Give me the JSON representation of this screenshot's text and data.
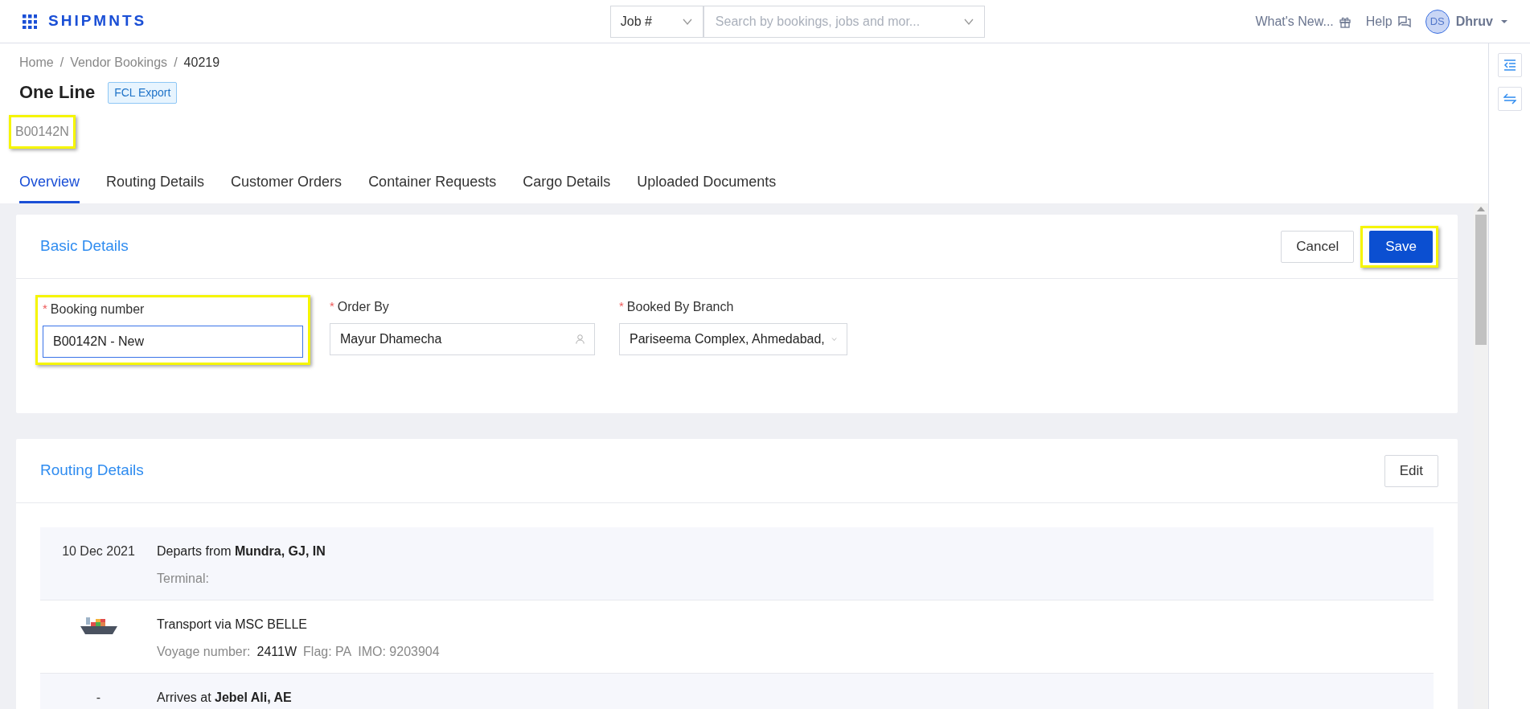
{
  "header": {
    "logo": "SHIPMNTS",
    "search_type": "Job #",
    "search": {
      "placeholder": "Search by bookings, jobs and mor..."
    },
    "whats_new": "What's New...",
    "help": "Help",
    "user": {
      "initials": "DS",
      "name": "Dhruv"
    }
  },
  "breadcrumb": [
    {
      "label": "Home",
      "kind": "link"
    },
    {
      "label": "/",
      "kind": "separator"
    },
    {
      "label": "Vendor Bookings",
      "kind": "link"
    },
    {
      "label": "/",
      "kind": "separator"
    },
    {
      "label": "40219",
      "kind": "current"
    }
  ],
  "title": "One Line",
  "badge": "FCL Export",
  "reference": {
    "text": "B00142N",
    "highlighted": true
  },
  "tabs": [
    {
      "label": "Overview",
      "selected": true
    },
    {
      "label": "Routing Details",
      "selected": false
    },
    {
      "label": "Customer Orders",
      "selected": false
    },
    {
      "label": "Container Requests",
      "selected": false
    },
    {
      "label": "Cargo Details",
      "selected": false
    },
    {
      "label": "Uploaded Documents",
      "selected": false
    }
  ],
  "basic_details": {
    "title": "Basic Details",
    "cancel": {
      "label": "Cancel"
    },
    "save": {
      "label": "Save",
      "highlighted": true
    },
    "fields": [
      {
        "label": "Booking number",
        "required_mark": "*",
        "value": "B00142N - New",
        "kind": "text",
        "focused": true,
        "highlighted": true
      },
      {
        "label": "Order By",
        "required_mark": "*",
        "value": "Mayur Dhamecha",
        "kind": "person",
        "focused": false,
        "highlighted": false
      },
      {
        "label": "Booked By Branch",
        "required_mark": "*",
        "value": "Pariseema Complex, Ahmedabad,",
        "kind": "select",
        "focused": false,
        "highlighted": false
      }
    ]
  },
  "routing_details": {
    "title": "Routing Details",
    "edit": "Edit",
    "rows": [
      {
        "kind": "departure",
        "date": "10 Dec 2021",
        "text": "Departs from **Mundra, GJ, IN**",
        "details": [
          {
            "text": "Terminal:",
            "kind": "label"
          }
        ]
      },
      {
        "kind": "transport",
        "text": "Transport via MSC BELLE",
        "details": [
          {
            "text": "Voyage number:",
            "kind": "label"
          },
          {
            "text": "2411W",
            "kind": "value"
          },
          {
            "text": "Flag: PA",
            "kind": "label"
          },
          {
            "text": "IMO: 9203904",
            "kind": "label"
          }
        ]
      },
      {
        "kind": "arrival",
        "date": "-",
        "text": "Arrives at **Jebel Ali, AE**"
      }
    ]
  }
}
